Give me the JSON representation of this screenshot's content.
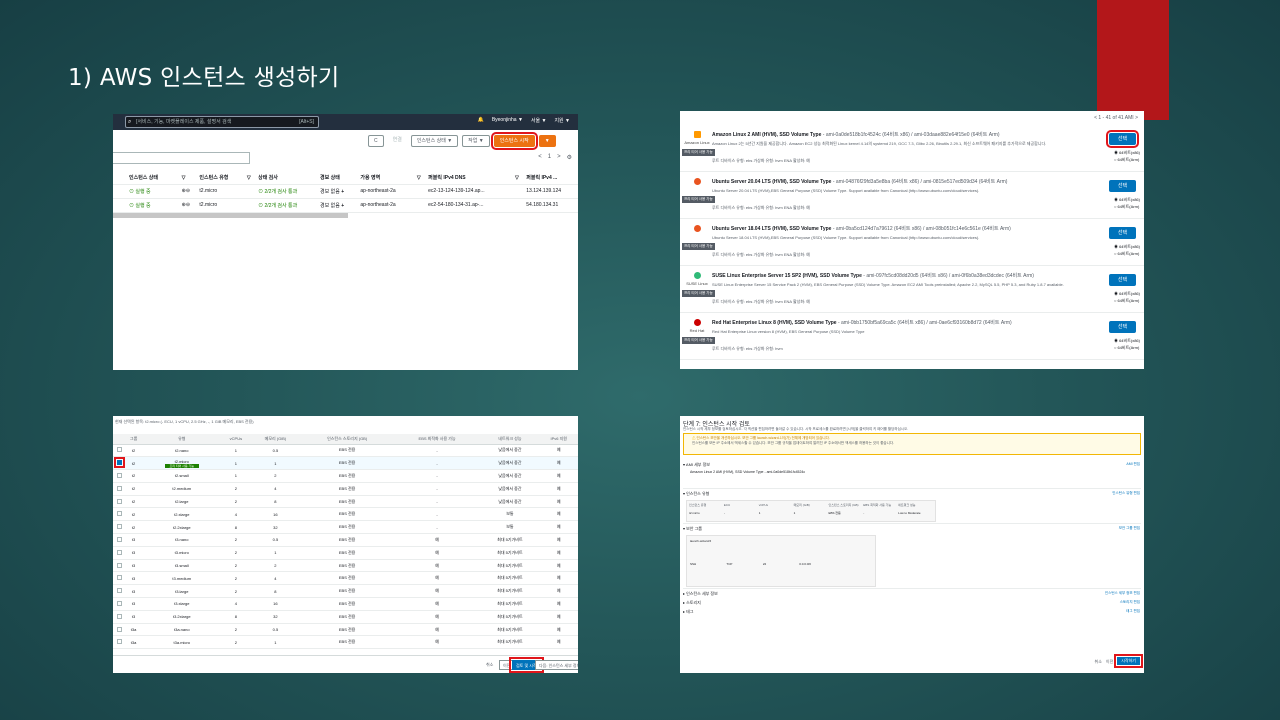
{
  "slide": {
    "title": "1) AWS 인스턴스 생성하기"
  },
  "shot1": {
    "search_placeholder": "[서비스, 기능, 마켓플레이스 제품, 설명서 검색",
    "search_shortcut": "[Alt+S]",
    "topbar": [
      "Byeonjinha ▼",
      "서울 ▼",
      "지원 ▼"
    ],
    "toolbar": {
      "refresh": "C",
      "connect": "연결",
      "state": "인스턴스 상태 ▼",
      "actions": "작업 ▼",
      "launch": "인스턴스 시작",
      "dropdown": "▼"
    },
    "pager": {
      "prev": "<",
      "page": "1",
      "next": ">",
      "settings": "⚙"
    },
    "columns": [
      "인스턴스 상태",
      "▽",
      "인스턴스 유형",
      "▽",
      "상태 검사",
      "경보 상태",
      "가용 영역",
      "▽",
      "퍼블릭 IPv4 DNS",
      "▽",
      "퍼블릭 IPv4 ..."
    ],
    "rows": [
      {
        "state": "실행 중",
        "type": "t2.micro",
        "check": "2/2개 검사 통과",
        "alarm": "경보 없음",
        "az": "ap-northeast-2a",
        "dns": "ec2-13-124-139-124.ap...",
        "ip": "13.124.139.124"
      },
      {
        "state": "실행 중",
        "type": "t2.micro",
        "check": "2/2개 검사 통과",
        "alarm": "경보 없음",
        "az": "ap-northeast-2a",
        "dns": "ec2-54-180-134-31.ap-...",
        "ip": "54.180.134.31"
      }
    ]
  },
  "shot2": {
    "pager": "< 1 - 41 of 41 AMI >",
    "select_label": "선택",
    "arch": [
      "64비트(x86)",
      "64비트(Arm)"
    ],
    "amis": [
      {
        "logo": "Amazon Linux",
        "badge": "프리 티어 사용 가능",
        "name": "Amazon Linux 2 AMI (HVM), SSD Volume Type",
        "ids": " - ami-0a0de518b1fc4524c (64비트 x86) / ami-03daae882e64f15e0 (64비트 Arm)",
        "desc": "Amazon Linux 2는 5년간 지원을 제공합니다. Amazon EC2 성능 최적화된 Linux kernel 4.14의 systemd 219, GCC 7.3, Glibc 2.26, Binutils 2.29.1, 최신 소프트웨어 패키지를 추가적으로 제공합니다.",
        "meta": "루트 디바이스 유형: ebs    가상화 유형: hvm    ENA 활성화: 예"
      },
      {
        "logo": "",
        "badge": "프리 티어 사용 가능",
        "name": "Ubuntu Server 20.04 LTS (HVM), SSD Volume Type",
        "ids": " - ami-04876f29fd3a5e8ba (64비트 x86) / ami-0815e517ed509d34 (64비트 Arm)",
        "desc": "Ubuntu Server 20.04 LTS (HVM),EBS General Purpose (SSD) Volume Type. Support available from Canonical (http://www.ubuntu.com/cloud/services).",
        "meta": "루트 디바이스 유형: ebs    가상화 유형: hvm    ENA 활성화: 예"
      },
      {
        "logo": "",
        "badge": "프리 티어 사용 가능",
        "name": "Ubuntu Server 18.04 LTS (HVM), SSD Volume Type",
        "ids": " - ami-0ba5cd124d7a79612 (64비트 x86) / ami-08b051fc14e6c561e (64비트 Arm)",
        "desc": "Ubuntu Server 18.04 LTS (HVM),EBS General Purpose (SSD) Volume Type. Support available from Canonical (http://www.ubuntu.com/cloud/services).",
        "meta": "루트 디바이스 유형: ebs    가상화 유형: hvm    ENA 활성화: 예"
      },
      {
        "logo": "SUSE Linux",
        "badge": "프리 티어 사용 가능",
        "name": "SUSE Linux Enterprise Server 15 SP2 (HVM), SSD Volume Type",
        "ids": " - ami-097fc5cd08dd20d5 (64비트 x86) / ami-0f6b0a38ed3dcdec (64비트 Arm)",
        "desc": "SUSE Linux Enterprise Server 15 Service Pack 2 (HVM), EBS General Purpose (SSD) Volume Type. Amazon EC2 AMI Tools preinstalled; Apache 2.2, MySQL 5.5, PHP 5.3, and Ruby 1.8.7 available.",
        "meta": "루트 디바이스 유형: ebs    가상화 유형: hvm    ENA 활성화: 예"
      },
      {
        "logo": "Red Hat",
        "badge": "프리 티어 사용 가능",
        "name": "Red Hat Enterprise Linux 8 (HVM), SSD Volume Type",
        "ids": " - ami-0bb1750bf5a69ca5c (64비트 x86) / ami-0ae6cf93160b8d72 (64비트 Arm)",
        "desc": "Red Hat Enterprise Linux version 8 (HVM), EBS General Purpose (SSD) Volume Type",
        "meta": "루트 디바이스 유형: ebs    가상화 유형: hvm"
      }
    ]
  },
  "shot3": {
    "hint": "현재 선택된 항목: t2.micro (- ECU, 1 vCPU, 2.5 GHz, -, 1 GiB 메모리, EBS 전용)",
    "columns": [
      "",
      "그룹",
      "유형",
      "vCPUs",
      "메모리 (GiB)",
      "인스턴스 스토리지 (GB)",
      "EBS 최적화 사용 가능",
      "네트워크 성능",
      "IPv6 지원"
    ],
    "free_tag": "프리 티어 사용 가능",
    "rows": [
      [
        "t2",
        "t2.nano",
        "1",
        "0.5",
        "EBS 전용",
        "-",
        "낮음에서 중간",
        "예"
      ],
      [
        "t2",
        "t2.micro",
        "1",
        "1",
        "EBS 전용",
        "-",
        "낮음에서 중간",
        "예"
      ],
      [
        "t2",
        "t2.small",
        "1",
        "2",
        "EBS 전용",
        "-",
        "낮음에서 중간",
        "예"
      ],
      [
        "t2",
        "t2.medium",
        "2",
        "4",
        "EBS 전용",
        "-",
        "낮음에서 중간",
        "예"
      ],
      [
        "t2",
        "t2.large",
        "2",
        "8",
        "EBS 전용",
        "-",
        "낮음에서 중간",
        "예"
      ],
      [
        "t2",
        "t2.xlarge",
        "4",
        "16",
        "EBS 전용",
        "-",
        "보통",
        "예"
      ],
      [
        "t2",
        "t2.2xlarge",
        "8",
        "32",
        "EBS 전용",
        "-",
        "보통",
        "예"
      ],
      [
        "t3",
        "t3.nano",
        "2",
        "0.5",
        "EBS 전용",
        "예",
        "최대 5기가비트",
        "예"
      ],
      [
        "t3",
        "t3.micro",
        "2",
        "1",
        "EBS 전용",
        "예",
        "최대 5기가비트",
        "예"
      ],
      [
        "t3",
        "t3.small",
        "2",
        "2",
        "EBS 전용",
        "예",
        "최대 5기가비트",
        "예"
      ],
      [
        "t3",
        "t3.medium",
        "2",
        "4",
        "EBS 전용",
        "예",
        "최대 5기가비트",
        "예"
      ],
      [
        "t3",
        "t3.large",
        "2",
        "8",
        "EBS 전용",
        "예",
        "최대 5기가비트",
        "예"
      ],
      [
        "t3",
        "t3.xlarge",
        "4",
        "16",
        "EBS 전용",
        "예",
        "최대 5기가비트",
        "예"
      ],
      [
        "t3",
        "t3.2xlarge",
        "8",
        "32",
        "EBS 전용",
        "예",
        "최대 5기가비트",
        "예"
      ],
      [
        "t3a",
        "t3a.nano",
        "2",
        "0.5",
        "EBS 전용",
        "예",
        "최대 5기가비트",
        "예"
      ],
      [
        "t3a",
        "t3a.micro",
        "2",
        "1",
        "EBS 전용",
        "예",
        "최대 5기가비트",
        "예"
      ]
    ],
    "buttons": {
      "cancel": "취소",
      "prev": "이전",
      "launch": "검토 및 시작",
      "next": "다음: 인스턴스 세부 정보 구성"
    }
  },
  "shot4": {
    "title": "단계 7: 인스턴스 시작 검토",
    "subtitle": "인스턴스 시작 세부 정보를 검토하십시오. 각 섹션을 편집하려면 돌아갈 수 있습니다. 시작 프로세스를 완료하려면 [시작]을 클릭하여 키 페어를 할당하십시오.",
    "warn_title": "인스턴스 보안을 개선하십시오. 보안 그룹 launch-wizard-1이(가) 전체에 개방되어 있습니다.",
    "warn_body": "인스턴스를 모든 IP 주소에서 액세스할 수 있습니다. 보안 그룹 규칙을 업데이트하여 알려진 IP 주소에서만 액세스를 허용하는 것이 좋습니다.",
    "sections": [
      "AMI 세부 정보",
      "인스턴스 유형",
      "보안 그룹",
      "인스턴스 세부 정보",
      "스토리지",
      "태그"
    ],
    "edits": [
      "AMI 편집",
      "인스턴스 유형 편집",
      "보안 그룹 편집",
      "인스턴스 세부 정보 편집",
      "스토리지 편집",
      "태그 편집"
    ],
    "ami_name": "Amazon Linux 2 AMI (HVM), SSD Volume Type - ami-0a0de518b1fc4524c",
    "itype_cols": [
      "인스턴스 유형",
      "ECU",
      "vCPUs",
      "메모리 (GiB)",
      "인스턴스 스토리지 (GB)",
      "EBS 최적화 사용 가능",
      "네트워크 성능"
    ],
    "itype_vals": [
      "t2.micro",
      "-",
      "1",
      "1",
      "EBS 전용",
      "-",
      "Low to Moderate"
    ],
    "sg_name": "launch-wizard-5",
    "rule_vals": [
      "SSH",
      "TCP",
      "22",
      "0.0.0.0/0",
      ""
    ],
    "buttons": {
      "cancel": "취소",
      "prev": "이전",
      "launch": "시작하기"
    }
  }
}
